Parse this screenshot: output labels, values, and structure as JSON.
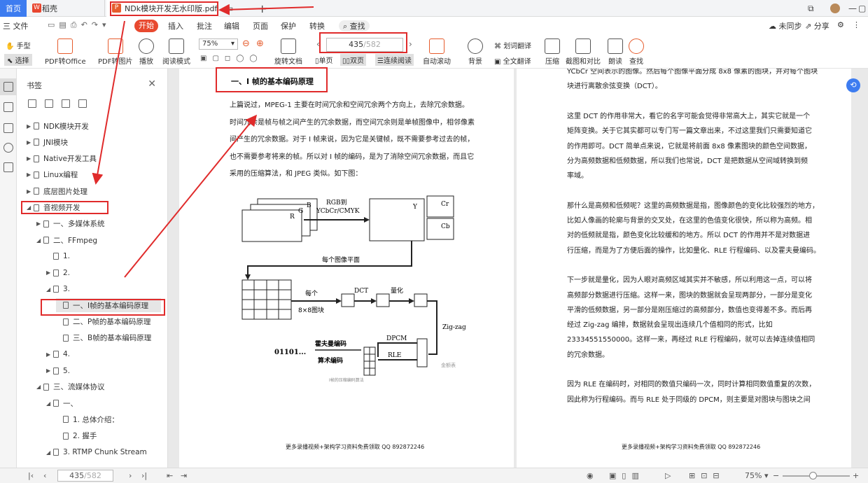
{
  "tabs": {
    "home": "首页",
    "wps": "稻壳",
    "pdf": "NDk模块开发无水印版.pdf",
    "add": "+"
  },
  "menu": {
    "file": "三 文件",
    "start": "开始",
    "insert": "插入",
    "annotate": "批注",
    "edit": "编辑",
    "page": "页面",
    "protect": "保护",
    "convert": "转换",
    "search": "查找",
    "sync": "未同步",
    "share": "分享"
  },
  "toolbar": {
    "hand": "手型",
    "select": "选择",
    "pdf_to_office": "PDF转Office",
    "pdf_to_image": "PDF转图片",
    "play": "播放",
    "read_mode": "阅读模式",
    "zoom": "75%",
    "rotate": "旋转文档",
    "page_current": "435",
    "page_total": "/582",
    "single": "单页",
    "double": "双页",
    "continuous": "连续阅读",
    "auto_scroll": "自动滚动",
    "background": "背景",
    "translate_word": "划词翻译",
    "translate_full": "全文翻译",
    "compress": "压缩",
    "screenshot": "截图和对比",
    "read_aloud": "朗读",
    "find": "查找"
  },
  "bookmarks": {
    "title": "书签",
    "items": [
      {
        "label": "NDK模块开发",
        "level": 0,
        "tri": "▶"
      },
      {
        "label": "JNI模块",
        "level": 0,
        "tri": "▶"
      },
      {
        "label": "Native开发工具",
        "level": 0,
        "tri": "▶"
      },
      {
        "label": "Linux编程",
        "level": 0,
        "tri": "▶"
      },
      {
        "label": "底层图片处理",
        "level": 0,
        "tri": "▶"
      },
      {
        "label": "音视频开发",
        "level": 0,
        "tri": "◢"
      },
      {
        "label": "一、多媒体系统",
        "level": 1,
        "tri": "▶"
      },
      {
        "label": "二、FFmpeg",
        "level": 1,
        "tri": "◢"
      },
      {
        "label": "1.",
        "level": 2,
        "tri": ""
      },
      {
        "label": "2.",
        "level": 2,
        "tri": "▶"
      },
      {
        "label": "3.",
        "level": 2,
        "tri": "◢"
      },
      {
        "label": "一、I帧的基本编码原理",
        "level": 3,
        "tri": ""
      },
      {
        "label": "二、P帧的基本编码原理",
        "level": 3,
        "tri": ""
      },
      {
        "label": "三、B帧的基本编码原理",
        "level": 3,
        "tri": ""
      },
      {
        "label": "4.",
        "level": 2,
        "tri": "▶"
      },
      {
        "label": "5.",
        "level": 2,
        "tri": "▶"
      },
      {
        "label": "三、流媒体协议",
        "level": 1,
        "tri": "◢"
      },
      {
        "label": "一、",
        "level": 2,
        "tri": "◢"
      },
      {
        "label": "1. 总体介绍：",
        "level": 3,
        "tri": ""
      },
      {
        "label": "2. 握手",
        "level": 3,
        "tri": ""
      },
      {
        "label": "3. RTMP Chunk Stream",
        "level": 2,
        "tri": "◢"
      }
    ]
  },
  "page_left": {
    "heading": "一、I 帧的基本编码原理",
    "lines": [
      "上篇说过，MPEG-1 主要在时间冗余和空间冗余两个方向上，去除冗余数据。",
      "时间冗余是帧与帧之间产生的冗余数据，而空间冗余则是单帧图像中，相邻像素",
      "间产生的冗余数据。对于 I 帧来说，因为它是关键帧，既不需要参考过去的帧，",
      "也不需要参考将来的帧。所以对 I 帧的编码，是为了消除空间冗余数据，而且它",
      "采用的压缩算法，和 JPEG 类似。如下图："
    ],
    "figure": {
      "rgb_to": "RGB到",
      "ycbcr": "YCbCr/CMYK",
      "r": "R",
      "g": "G",
      "b": "B",
      "y": "Y",
      "cr": "Cr",
      "cb": "Cb",
      "plane": "每个图像平面",
      "each": "每个",
      "block": "8×8图块",
      "dct": "DCT",
      "quant": "量化",
      "zigzag": "Zig-zag",
      "dpcm": "DPCM",
      "rle": "RLE",
      "huffman": "霍夫曼编码",
      "arith": "算术编码",
      "bits": "01101...",
      "caption": "I帧的压缩编码算法",
      "watermark": "金额表"
    },
    "footer": "更多录播视频+架构学习资料免费领取 QQ 892872246"
  },
  "page_right": {
    "lines": [
      "YCbCr 空间表示的图像。然后每个图像平面分成 8x8 像素的图块，并对每个图块",
      "块进行离散余弦变换（DCT）。",
      "",
      "这里 DCT 的作用非常大，看它的名字可能会觉得非常高大上，其实它就是一个",
      "矩阵变换。关于它其实都可以专门写一篇文章出来，不过这里我们只需要知道它",
      "的作用即可。DCT 简单点来说，它就是将前面 8x8 像素图块的颜色空间数据，",
      "分为高频数据和低频数据，所以我们也常说，DCT 是把数据从空间域转换到频",
      "率域。",
      "",
      "那什么是高频和低频呢？这里的高频数据是指，图像颜色的变化比较强烈的地方，",
      "比如人像画的轮廓与背景的交叉处，在这里的色值变化很快，所以称为高频。相",
      "对的低频就是指，颜色变化比较缓和的地方。所以 DCT 的作用并不是对数据进",
      "行压缩，而是为了方便后面的操作，比如量化、RLE 行程编码、以及霍夫曼编码。",
      "",
      "下一步就是量化，因为人眼对高频区域其实并不敏感，所以利用这一点，可以将",
      "高频部分数据进行压缩。这样一来，图块的数据就会呈现两部分，一部分是变化",
      "平滑的低频数据，另一部分是刚压缩过的高频部分，数值也变得差不多。而后再",
      "经过 Zig-zag 编排，数据就会呈现出连续几个值相同的形式，比如",
      "23334551550000。这样一来，再经过 RLE 行程编码，就可以去掉连续值相同",
      "的冗余数据。",
      "",
      "因为 RLE 在编码时，对相同的数值只编码一次，同时计算相同数值重复的次数，",
      "因此称为行程编码。而与 RLE 处于同级的 DPCM，则主要是对图块与图块之间"
    ],
    "footer": "更多录播视频+架构学习资料免费领取 QQ 892872246"
  },
  "status": {
    "page_current": "435",
    "page_total": "/582",
    "zoom": "75%"
  }
}
